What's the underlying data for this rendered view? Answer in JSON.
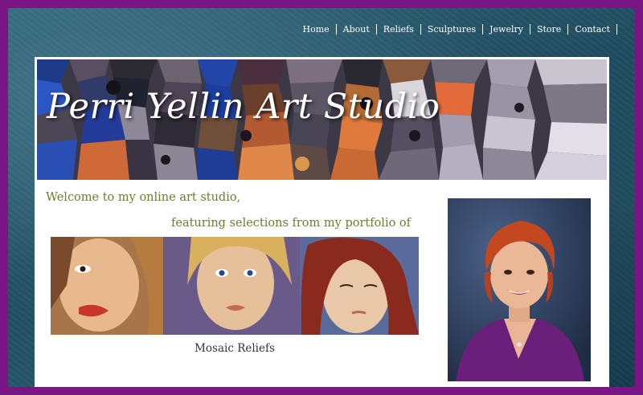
{
  "nav": {
    "items": [
      {
        "label": "Home"
      },
      {
        "label": "About"
      },
      {
        "label": "Reliefs"
      },
      {
        "label": "Sculptures"
      },
      {
        "label": "Jewelry"
      },
      {
        "label": "Store"
      },
      {
        "label": "Contact"
      }
    ]
  },
  "banner": {
    "title": "Perri Yellin Art Studio"
  },
  "intro": {
    "welcome": "Welcome to my online art studio,",
    "featuring": "featuring selections from my portfolio of"
  },
  "gallery": {
    "caption": "Mosaic Reliefs"
  },
  "colors": {
    "border": "#7a1585",
    "intro_text": "#6b7d2a",
    "nav_text": "#ffffff"
  }
}
